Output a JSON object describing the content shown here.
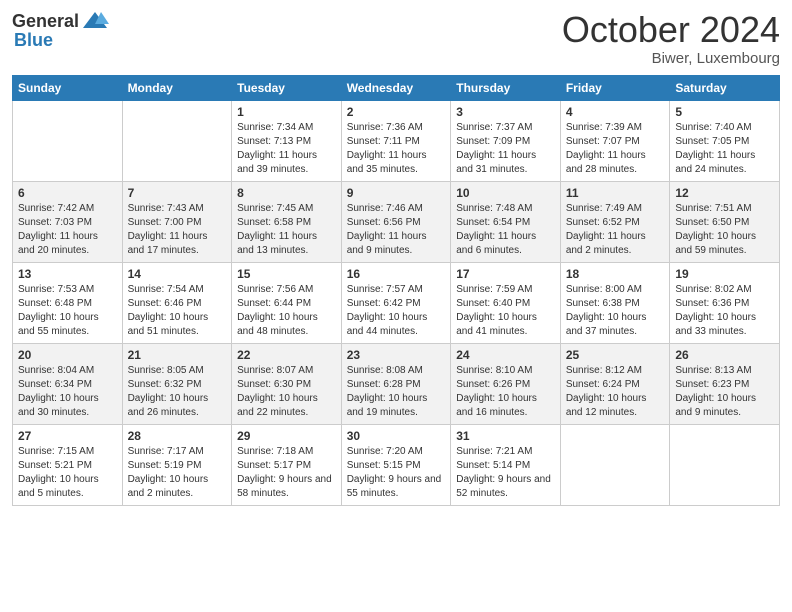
{
  "header": {
    "logo_general": "General",
    "logo_blue": "Blue",
    "month_title": "October 2024",
    "location": "Biwer, Luxembourg"
  },
  "days_of_week": [
    "Sunday",
    "Monday",
    "Tuesday",
    "Wednesday",
    "Thursday",
    "Friday",
    "Saturday"
  ],
  "weeks": [
    [
      {
        "day": "",
        "empty": true
      },
      {
        "day": "",
        "empty": true
      },
      {
        "day": "1",
        "sunrise": "Sunrise: 7:34 AM",
        "sunset": "Sunset: 7:13 PM",
        "daylight": "Daylight: 11 hours and 39 minutes."
      },
      {
        "day": "2",
        "sunrise": "Sunrise: 7:36 AM",
        "sunset": "Sunset: 7:11 PM",
        "daylight": "Daylight: 11 hours and 35 minutes."
      },
      {
        "day": "3",
        "sunrise": "Sunrise: 7:37 AM",
        "sunset": "Sunset: 7:09 PM",
        "daylight": "Daylight: 11 hours and 31 minutes."
      },
      {
        "day": "4",
        "sunrise": "Sunrise: 7:39 AM",
        "sunset": "Sunset: 7:07 PM",
        "daylight": "Daylight: 11 hours and 28 minutes."
      },
      {
        "day": "5",
        "sunrise": "Sunrise: 7:40 AM",
        "sunset": "Sunset: 7:05 PM",
        "daylight": "Daylight: 11 hours and 24 minutes."
      }
    ],
    [
      {
        "day": "6",
        "sunrise": "Sunrise: 7:42 AM",
        "sunset": "Sunset: 7:03 PM",
        "daylight": "Daylight: 11 hours and 20 minutes."
      },
      {
        "day": "7",
        "sunrise": "Sunrise: 7:43 AM",
        "sunset": "Sunset: 7:00 PM",
        "daylight": "Daylight: 11 hours and 17 minutes."
      },
      {
        "day": "8",
        "sunrise": "Sunrise: 7:45 AM",
        "sunset": "Sunset: 6:58 PM",
        "daylight": "Daylight: 11 hours and 13 minutes."
      },
      {
        "day": "9",
        "sunrise": "Sunrise: 7:46 AM",
        "sunset": "Sunset: 6:56 PM",
        "daylight": "Daylight: 11 hours and 9 minutes."
      },
      {
        "day": "10",
        "sunrise": "Sunrise: 7:48 AM",
        "sunset": "Sunset: 6:54 PM",
        "daylight": "Daylight: 11 hours and 6 minutes."
      },
      {
        "day": "11",
        "sunrise": "Sunrise: 7:49 AM",
        "sunset": "Sunset: 6:52 PM",
        "daylight": "Daylight: 11 hours and 2 minutes."
      },
      {
        "day": "12",
        "sunrise": "Sunrise: 7:51 AM",
        "sunset": "Sunset: 6:50 PM",
        "daylight": "Daylight: 10 hours and 59 minutes."
      }
    ],
    [
      {
        "day": "13",
        "sunrise": "Sunrise: 7:53 AM",
        "sunset": "Sunset: 6:48 PM",
        "daylight": "Daylight: 10 hours and 55 minutes."
      },
      {
        "day": "14",
        "sunrise": "Sunrise: 7:54 AM",
        "sunset": "Sunset: 6:46 PM",
        "daylight": "Daylight: 10 hours and 51 minutes."
      },
      {
        "day": "15",
        "sunrise": "Sunrise: 7:56 AM",
        "sunset": "Sunset: 6:44 PM",
        "daylight": "Daylight: 10 hours and 48 minutes."
      },
      {
        "day": "16",
        "sunrise": "Sunrise: 7:57 AM",
        "sunset": "Sunset: 6:42 PM",
        "daylight": "Daylight: 10 hours and 44 minutes."
      },
      {
        "day": "17",
        "sunrise": "Sunrise: 7:59 AM",
        "sunset": "Sunset: 6:40 PM",
        "daylight": "Daylight: 10 hours and 41 minutes."
      },
      {
        "day": "18",
        "sunrise": "Sunrise: 8:00 AM",
        "sunset": "Sunset: 6:38 PM",
        "daylight": "Daylight: 10 hours and 37 minutes."
      },
      {
        "day": "19",
        "sunrise": "Sunrise: 8:02 AM",
        "sunset": "Sunset: 6:36 PM",
        "daylight": "Daylight: 10 hours and 33 minutes."
      }
    ],
    [
      {
        "day": "20",
        "sunrise": "Sunrise: 8:04 AM",
        "sunset": "Sunset: 6:34 PM",
        "daylight": "Daylight: 10 hours and 30 minutes."
      },
      {
        "day": "21",
        "sunrise": "Sunrise: 8:05 AM",
        "sunset": "Sunset: 6:32 PM",
        "daylight": "Daylight: 10 hours and 26 minutes."
      },
      {
        "day": "22",
        "sunrise": "Sunrise: 8:07 AM",
        "sunset": "Sunset: 6:30 PM",
        "daylight": "Daylight: 10 hours and 22 minutes."
      },
      {
        "day": "23",
        "sunrise": "Sunrise: 8:08 AM",
        "sunset": "Sunset: 6:28 PM",
        "daylight": "Daylight: 10 hours and 19 minutes."
      },
      {
        "day": "24",
        "sunrise": "Sunrise: 8:10 AM",
        "sunset": "Sunset: 6:26 PM",
        "daylight": "Daylight: 10 hours and 16 minutes."
      },
      {
        "day": "25",
        "sunrise": "Sunrise: 8:12 AM",
        "sunset": "Sunset: 6:24 PM",
        "daylight": "Daylight: 10 hours and 12 minutes."
      },
      {
        "day": "26",
        "sunrise": "Sunrise: 8:13 AM",
        "sunset": "Sunset: 6:23 PM",
        "daylight": "Daylight: 10 hours and 9 minutes."
      }
    ],
    [
      {
        "day": "27",
        "sunrise": "Sunrise: 7:15 AM",
        "sunset": "Sunset: 5:21 PM",
        "daylight": "Daylight: 10 hours and 5 minutes."
      },
      {
        "day": "28",
        "sunrise": "Sunrise: 7:17 AM",
        "sunset": "Sunset: 5:19 PM",
        "daylight": "Daylight: 10 hours and 2 minutes."
      },
      {
        "day": "29",
        "sunrise": "Sunrise: 7:18 AM",
        "sunset": "Sunset: 5:17 PM",
        "daylight": "Daylight: 9 hours and 58 minutes."
      },
      {
        "day": "30",
        "sunrise": "Sunrise: 7:20 AM",
        "sunset": "Sunset: 5:15 PM",
        "daylight": "Daylight: 9 hours and 55 minutes."
      },
      {
        "day": "31",
        "sunrise": "Sunrise: 7:21 AM",
        "sunset": "Sunset: 5:14 PM",
        "daylight": "Daylight: 9 hours and 52 minutes."
      },
      {
        "day": "",
        "empty": true
      },
      {
        "day": "",
        "empty": true
      }
    ]
  ]
}
